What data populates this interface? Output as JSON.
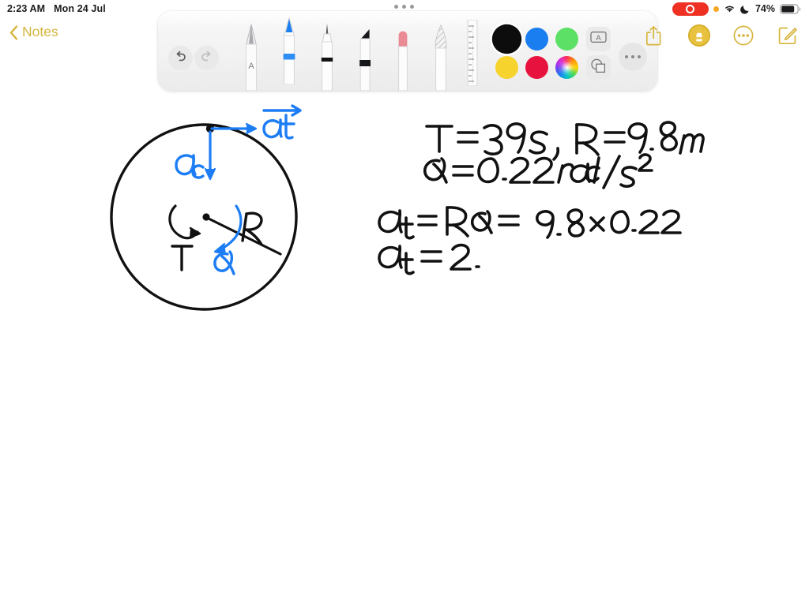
{
  "status_bar": {
    "time": "2:23 AM",
    "date": "Mon 24 Jul",
    "recording_icon": "screen-record-icon",
    "orange_dot_icon": "mic-in-use-indicator",
    "wifi_icon": "wifi-icon",
    "focus_icon": "do-not-disturb-moon-icon",
    "battery_percent": "74%",
    "battery_icon": "battery-icon"
  },
  "nav": {
    "back_label": "Notes",
    "back_icon": "chevron-left-icon"
  },
  "actions": [
    {
      "name": "share-button",
      "icon": "share-up-arrow-icon"
    },
    {
      "name": "markup-toggle-button",
      "icon": "pen-in-circle-icon"
    },
    {
      "name": "more-options-button",
      "icon": "ellipsis-circle-icon"
    },
    {
      "name": "compose-note-button",
      "icon": "compose-pencil-square-icon"
    }
  ],
  "toolbar": {
    "drag_handle_icon": "drag-handle-dots-icon",
    "undo": {
      "label": "Undo",
      "icon": "undo-arrow-icon",
      "enabled": true
    },
    "redo": {
      "label": "Redo",
      "icon": "redo-arrow-icon",
      "enabled": false
    },
    "tools": [
      {
        "name": "pencil-tool",
        "label": "Pencil",
        "selected": false
      },
      {
        "name": "pen-tool",
        "label": "Pen",
        "selected": true
      },
      {
        "name": "ink-pen-tool",
        "label": "Ink Pen",
        "selected": false
      },
      {
        "name": "marker-tool",
        "label": "Marker",
        "selected": false
      },
      {
        "name": "eraser-tool",
        "label": "Eraser",
        "selected": false
      },
      {
        "name": "lasso-tool",
        "label": "Lasso",
        "selected": false
      },
      {
        "name": "ruler-tool",
        "label": "Ruler",
        "selected": false
      }
    ],
    "colors": [
      {
        "name": "color-black",
        "hex": "#0d0d0d",
        "selected": true
      },
      {
        "name": "color-blue",
        "hex": "#1a7ef0",
        "selected": false
      },
      {
        "name": "color-green",
        "hex": "#5ce065",
        "selected": false
      },
      {
        "name": "color-yellow",
        "hex": "#f6d32d",
        "selected": false
      },
      {
        "name": "color-crimson",
        "hex": "#e8123f",
        "selected": false
      },
      {
        "name": "color-picker",
        "hex": "rainbow",
        "selected": false
      }
    ],
    "text_button_icon": "text-box-icon",
    "shapes_button_icon": "shapes-icon",
    "more_button_icon": "ellipsis-icon"
  },
  "note": {
    "diagram": {
      "name": "rotating-disk-diagram",
      "circle_label_radius": "R",
      "period_label": "T",
      "angular_accel_label": "α",
      "tangential_accel_label": "a⃗t",
      "centripetal_accel_label": "ac",
      "ink_colors": {
        "black": "#111111",
        "blue": "#1d7df5"
      }
    },
    "equations": [
      {
        "name": "given-line-1",
        "text": "T = 39s ,   R = 9.8 m"
      },
      {
        "name": "given-line-2",
        "text": "α = 0.22 rad/s²"
      },
      {
        "name": "work-line-1",
        "text": "at = Rα = 9.8 × 0.22"
      },
      {
        "name": "work-line-2",
        "text": "at = 2."
      }
    ]
  }
}
